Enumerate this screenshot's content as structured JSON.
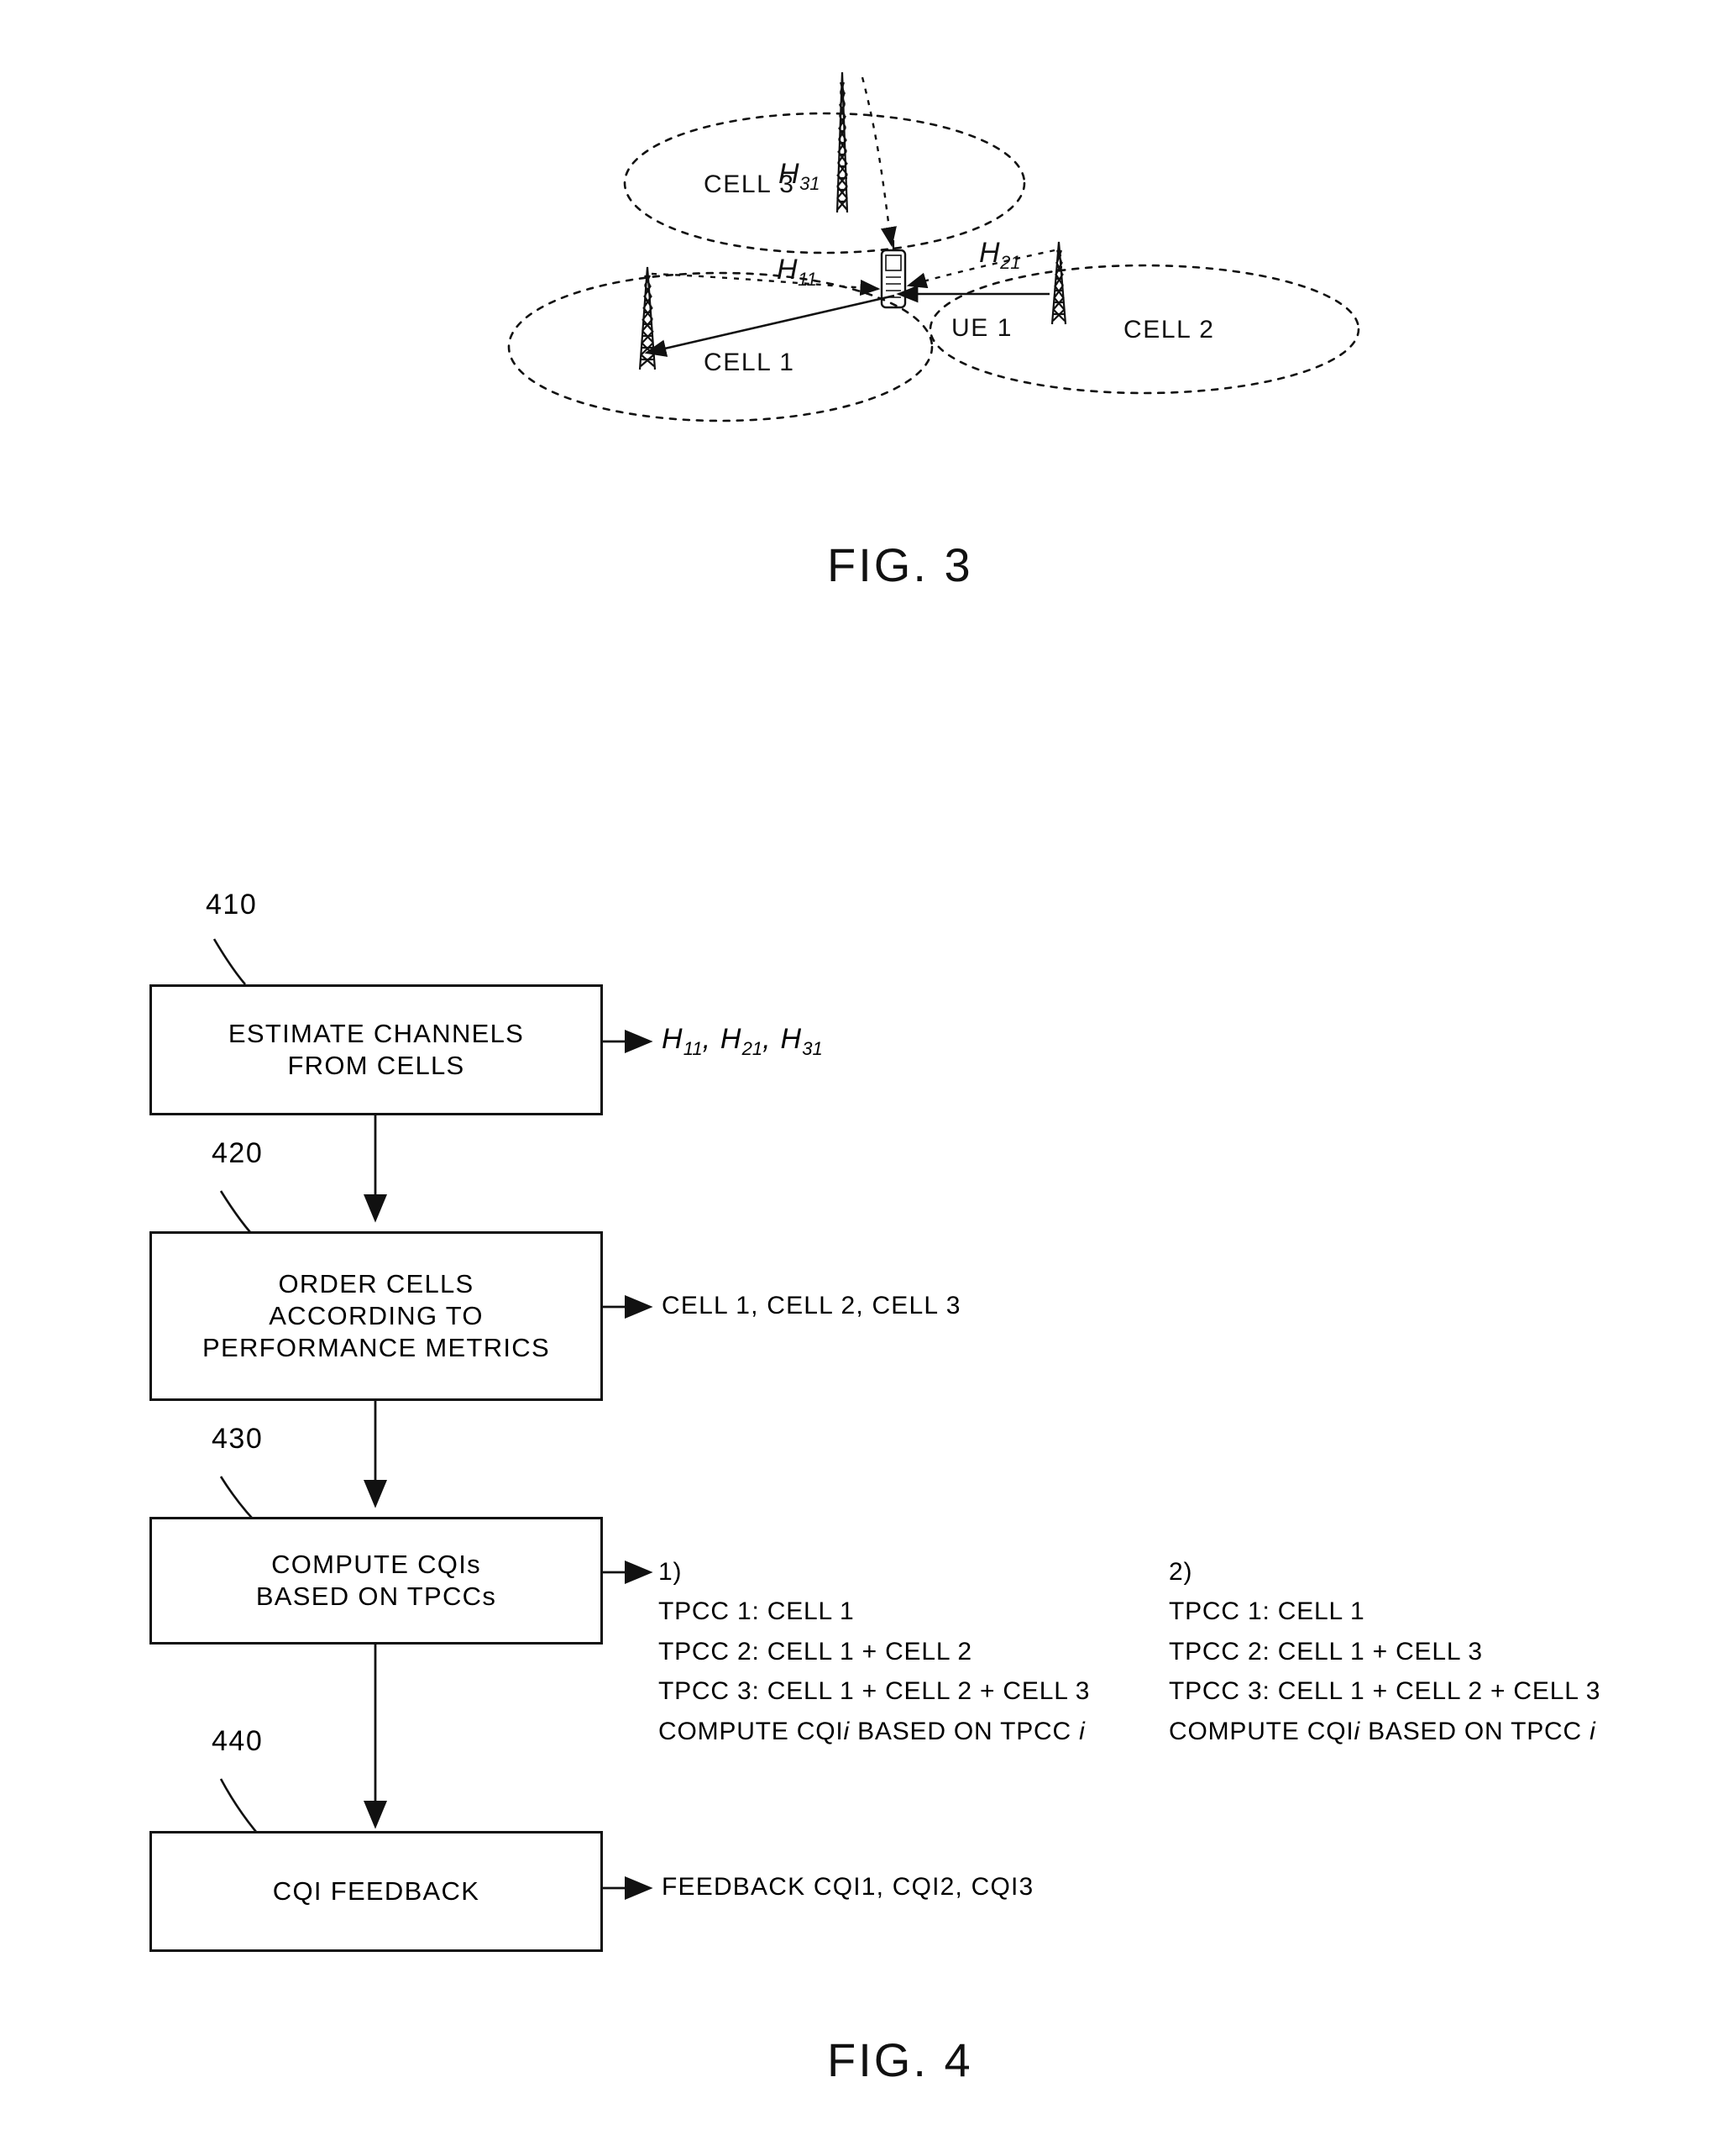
{
  "figures": [
    {
      "id": "fig3",
      "label": "FIG. 3",
      "cells": [
        {
          "name": "cell-3",
          "label": "CELL 3"
        },
        {
          "name": "cell-1",
          "label": "CELL 1"
        },
        {
          "name": "cell-2",
          "label": "CELL 2"
        }
      ],
      "ue": {
        "name": "ue-1",
        "label": "UE 1"
      },
      "channels": [
        {
          "name": "channel-h11",
          "base": "H",
          "sub": "11"
        },
        {
          "name": "channel-h21",
          "base": "H",
          "sub": "21"
        },
        {
          "name": "channel-h31",
          "base": "H",
          "sub": "31"
        }
      ]
    },
    {
      "id": "fig4",
      "label": "FIG. 4"
    }
  ],
  "flowchart": {
    "steps": [
      {
        "ref": "410",
        "lines": [
          "ESTIMATE CHANNELS",
          "FROM CELLS"
        ],
        "output_kind": "channels",
        "output_channels": [
          {
            "base": "H",
            "sub": "11",
            "sep": ", "
          },
          {
            "base": "H",
            "sub": "21",
            "sep": ", "
          },
          {
            "base": "H",
            "sub": "31",
            "sep": ""
          }
        ]
      },
      {
        "ref": "420",
        "lines": [
          "ORDER CELLS",
          "ACCORDING TO",
          "PERFORMANCE METRICS"
        ],
        "output_kind": "text",
        "output_text": "CELL 1, CELL 2, CELL 3"
      },
      {
        "ref": "430",
        "lines": [
          "COMPUTE CQIs",
          "BASED ON TPCCs"
        ],
        "output_kind": "tpcc"
      },
      {
        "ref": "440",
        "lines": [
          "CQI FEEDBACK"
        ],
        "output_kind": "text",
        "output_text": "FEEDBACK CQI1, CQI2, CQI3"
      }
    ],
    "tpcc_options": [
      {
        "index": "1)",
        "rows": [
          "TPCC 1: CELL 1",
          "TPCC 2: CELL 1 + CELL 2",
          "TPCC 3: CELL 1 + CELL 2 + CELL 3"
        ],
        "compute_prefix": "COMPUTE CQI",
        "compute_var1": "i",
        "compute_middle": " BASED ON TPCC ",
        "compute_var2": "i"
      },
      {
        "index": "2)",
        "rows": [
          "TPCC 1: CELL 1",
          "TPCC 2: CELL 1 + CELL 3",
          "TPCC 3: CELL 1 + CELL 2 + CELL 3"
        ],
        "compute_prefix": "COMPUTE CQI",
        "compute_var1": "i",
        "compute_middle": " BASED ON TPCC ",
        "compute_var2": "i"
      }
    ]
  },
  "colors": {
    "ink": "#111111",
    "paper": "#ffffff"
  }
}
